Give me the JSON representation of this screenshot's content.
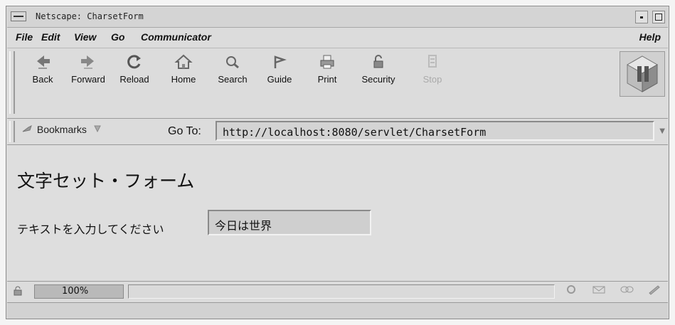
{
  "window": {
    "title": "Netscape: CharsetForm"
  },
  "menubar": {
    "file": "File",
    "edit": "Edit",
    "view": "View",
    "go": "Go",
    "communicator": "Communicator",
    "help": "Help"
  },
  "toolbar": {
    "back": "Back",
    "forward": "Forward",
    "reload": "Reload",
    "home": "Home",
    "search": "Search",
    "guide": "Guide",
    "print": "Print",
    "security": "Security",
    "stop": "Stop"
  },
  "location": {
    "bookmarks_label": "Bookmarks",
    "goto_label": "Go To:",
    "url": "http://localhost:8080/servlet/CharsetForm"
  },
  "page": {
    "title": "文字セット・フォーム",
    "field_label": "テキストを入力してください",
    "field_value": "今日は世界"
  },
  "status": {
    "progress": "100%"
  }
}
